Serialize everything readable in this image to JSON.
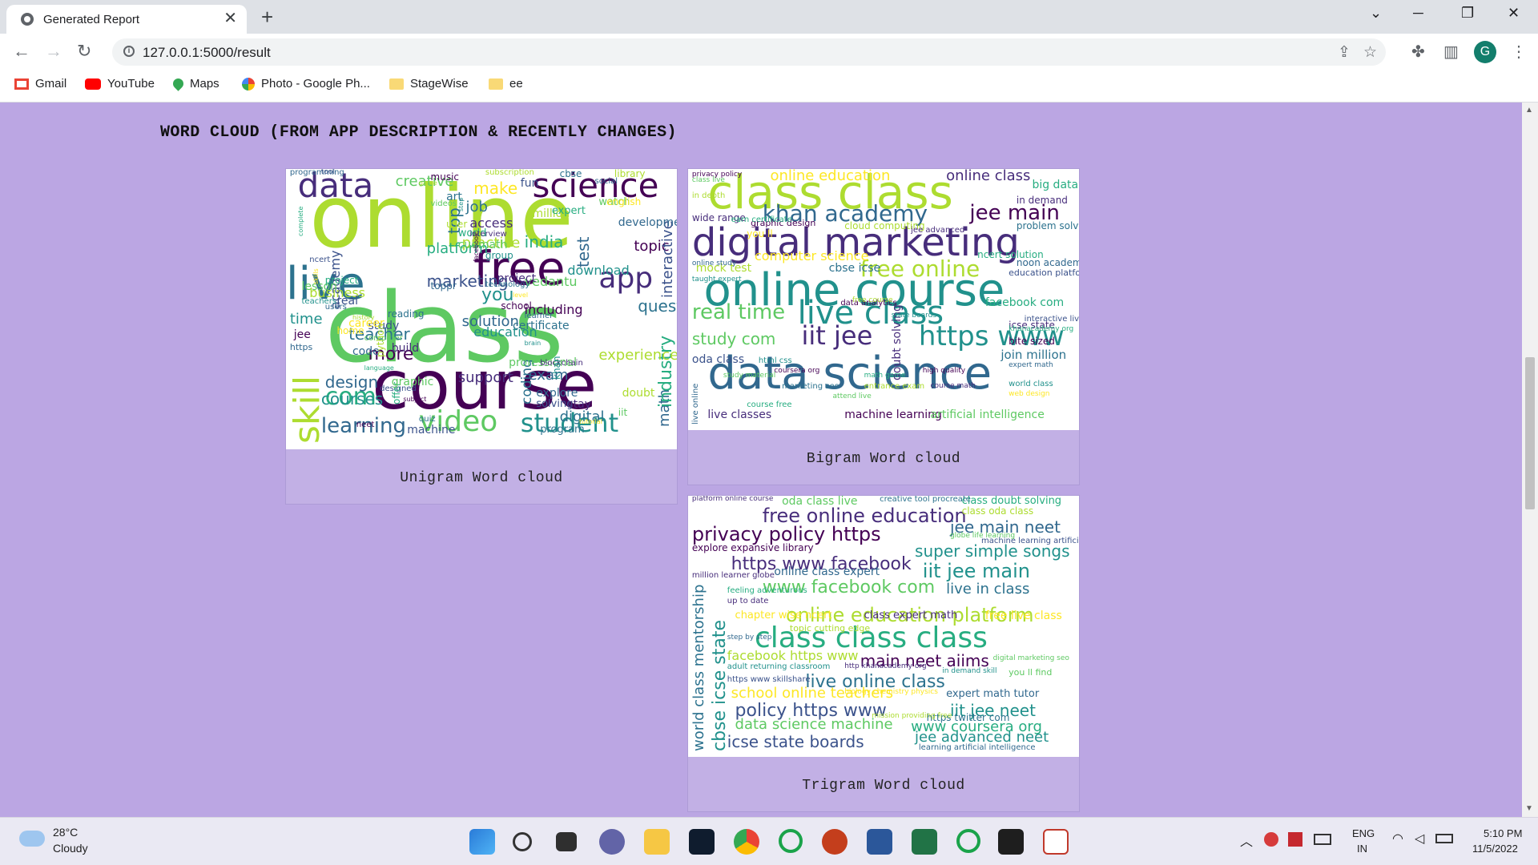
{
  "browser": {
    "tab_title": "Generated Report",
    "tab_close": "✕",
    "new_tab": "+",
    "url": "127.0.0.1:5000/result",
    "profile_initial": "G",
    "window": {
      "minimize": "─",
      "restore": "❐",
      "close": "✕",
      "tab_search": "⌄"
    },
    "bookmarks": [
      {
        "label": "Gmail",
        "icon": "gmail-icon",
        "color": "#ea4335"
      },
      {
        "label": "YouTube",
        "icon": "youtube-icon",
        "color": "#ff0000"
      },
      {
        "label": "Maps",
        "icon": "maps-icon",
        "color": "#34a853"
      },
      {
        "label": "Photo - Google Ph...",
        "icon": "photos-icon",
        "color": "#fbbc04"
      },
      {
        "label": "StageWise",
        "icon": "folder-icon",
        "color": "#f9d976"
      },
      {
        "label": "ee",
        "icon": "folder-icon",
        "color": "#f9d976"
      }
    ]
  },
  "page": {
    "heading": "WORD CLOUD (FROM APP DESCRIPTION & RECENTLY CHANGES)",
    "unigram_caption": "Unigram Word cloud",
    "bigram_caption": "Bigram Word cloud",
    "trigram_caption": "Trigram Word cloud",
    "unigram_words": [
      "online",
      "class",
      "course",
      "live",
      "free",
      "data",
      "science",
      "app",
      "skill",
      "video",
      "student",
      "learning",
      "com",
      "design",
      "courses",
      "teacher",
      "more",
      "marketing",
      "make",
      "job",
      "practice",
      "world",
      "india",
      "test",
      "topic",
      "question",
      "coding",
      "math",
      "industry",
      "digital",
      "experience",
      "interactive",
      "education",
      "support",
      "business",
      "academy",
      "platform",
      "access",
      "time",
      "study",
      "career",
      "build",
      "download",
      "professional",
      "program",
      "explore",
      "solving",
      "exam",
      "million",
      "fun",
      "watch",
      "cbse",
      "library",
      "programming",
      "tool",
      "creative",
      "subscription",
      "solution",
      "including",
      "vedantu",
      "you",
      "reading",
      "jee",
      "lesson",
      "teachers",
      "top",
      "https",
      "iit",
      "doubt",
      "toppr",
      "neet",
      "expert",
      "skills",
      "users",
      "home",
      "code",
      "language",
      "designed",
      "offer",
      "machine",
      "game",
      "videos",
      "user",
      "cuemath",
      "facebook",
      "technology",
      "school",
      "certificate",
      "brain",
      "blockchain",
      "khan",
      "stay",
      "tutorial",
      "social",
      "english",
      "development",
      "complete",
      "ncert",
      "project",
      "real",
      "history",
      "computer",
      "python",
      "graphic",
      "subject",
      "quiz",
      "music",
      "art",
      "step",
      "interview",
      "group",
      "project",
      "level",
      "learner"
    ],
    "bigram_words": [
      "class class",
      "data science",
      "online course",
      "digital marketing",
      "live class",
      "iit jee",
      "https www",
      "khan academy",
      "jee main",
      "real time",
      "free online",
      "study com",
      "online education",
      "online class",
      "big data",
      "in demand",
      "computer science",
      "cbse icse",
      "mock test",
      "oda class",
      "join million",
      "live classes",
      "machine learning",
      "artificial intelligence",
      "facebook com",
      "icse state",
      "bite sized",
      "interactive live",
      "ncert solution",
      "noon academy",
      "education platform",
      "problem solving",
      "cloud computing",
      "graphic design",
      "you ll",
      "wide range",
      "in depth",
      "privacy policy",
      "class live",
      "jee advanced",
      "data analytics",
      "doubt solving",
      "course free",
      "live online",
      "world class",
      "web design",
      "entrance exam",
      "high quality",
      "study material",
      "math game",
      "online study",
      "taught expert",
      "earn certificate",
      "free course",
      "html css",
      "marketing seo",
      "course math",
      "coursera org",
      "attend live",
      "khanacademy org",
      "expert math",
      "state boards"
    ],
    "trigram_words": [
      "class class class",
      "free online education",
      "privacy policy https",
      "jee main neet",
      "super simple songs",
      "https www facebook",
      "iit jee main",
      "www facebook com",
      "online education platform",
      "live in class",
      "main neet aiims",
      "live online class",
      "school online teachers",
      "policy https www",
      "iit jee neet",
      "data science machine",
      "www coursera org",
      "icse state boards",
      "jee advanced neet",
      "world class mentorship",
      "cbse icse state",
      "class doubt solving",
      "class oda class",
      "oda class live",
      "facebook https www",
      "online class expert",
      "explore expansive library",
      "chapter wise ncert",
      "class expert math",
      "topic cutting edge",
      "free live class",
      "https twitter com",
      "expert math tutor",
      "learning artificial intelligence",
      "you ll find",
      "creative tool procreate",
      "platform online course",
      "machine learning artificial",
      "globe life learning",
      "million learner globe",
      "step by step",
      "in demand skill",
      "feeling adventurous",
      "mission providing free",
      "adult returning classroom",
      "biology chemistry physics",
      "http khanacademy org",
      "https www skillshare",
      "digital marketing seo",
      "up to date"
    ]
  },
  "taskbar": {
    "weather_temp": "28°C",
    "weather_cond": "Cloudy",
    "lang_top": "ENG",
    "lang_bottom": "IN",
    "time": "5:10 PM",
    "date": "11/5/2022",
    "tray_arrow": "︿"
  }
}
